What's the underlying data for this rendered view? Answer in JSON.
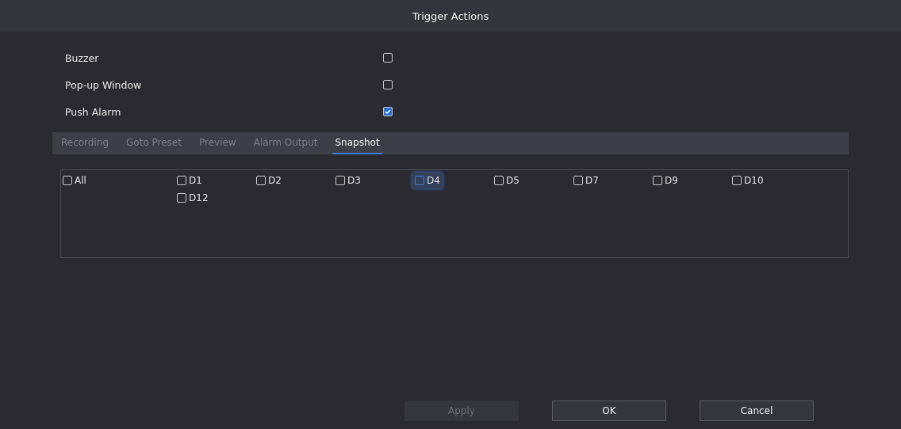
{
  "window": {
    "title": "Trigger Actions"
  },
  "options": [
    {
      "label": "Buzzer",
      "checked": false
    },
    {
      "label": "Pop-up Window",
      "checked": false
    },
    {
      "label": "Push Alarm",
      "checked": true
    }
  ],
  "tabs": [
    {
      "label": "Recording",
      "selected": false
    },
    {
      "label": "Goto Preset",
      "selected": false
    },
    {
      "label": "Preview",
      "selected": false
    },
    {
      "label": "Alarm Output",
      "selected": false
    },
    {
      "label": "Snapshot",
      "selected": true
    }
  ],
  "all": {
    "label": "All",
    "checked": false
  },
  "channels": [
    {
      "label": "D1",
      "checked": false,
      "selected": false
    },
    {
      "label": "D2",
      "checked": false,
      "selected": false
    },
    {
      "label": "D3",
      "checked": false,
      "selected": false
    },
    {
      "label": "D4",
      "checked": false,
      "selected": true
    },
    {
      "label": "D5",
      "checked": false,
      "selected": false
    },
    {
      "label": "D7",
      "checked": false,
      "selected": false
    },
    {
      "label": "D9",
      "checked": false,
      "selected": false
    },
    {
      "label": "D10",
      "checked": false,
      "selected": false
    },
    {
      "label": "D12",
      "checked": false,
      "selected": false
    }
  ],
  "buttons": [
    {
      "label": "Apply",
      "disabled": true
    },
    {
      "label": "OK",
      "disabled": false
    },
    {
      "label": "Cancel",
      "disabled": false
    }
  ]
}
